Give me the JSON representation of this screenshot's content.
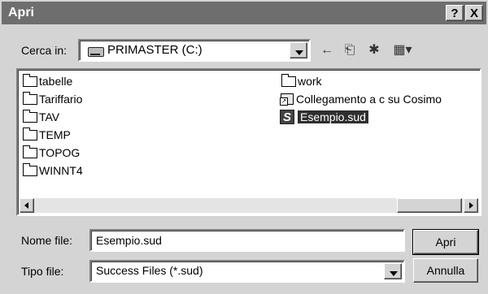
{
  "window": {
    "title": "Apri",
    "help_label": "?",
    "close_label": "X"
  },
  "look_in": {
    "label": "Cerca in:",
    "value": "PRIMASTER (C:)"
  },
  "toolbar": {
    "back_glyph": "←",
    "up_glyph": "⎗",
    "new_folder_glyph": "✱",
    "view_glyph": "▦▾"
  },
  "files": {
    "col1": [
      "tabelle",
      "Tariffario",
      "TAV",
      "TEMP",
      "TOPOG",
      "WINNT4"
    ],
    "col2_folder": "work",
    "col2_shortcut": "Collegamento a c su Cosimo",
    "col2_selected": "Esempio.sud",
    "selected_icon_letter": "S"
  },
  "filename": {
    "label": "Nome file:",
    "value": "Esempio.sud"
  },
  "filetype": {
    "label": "Tipo file:",
    "value": "Success Files (*.sud)"
  },
  "buttons": {
    "open": "Apri",
    "cancel": "Annulla"
  }
}
